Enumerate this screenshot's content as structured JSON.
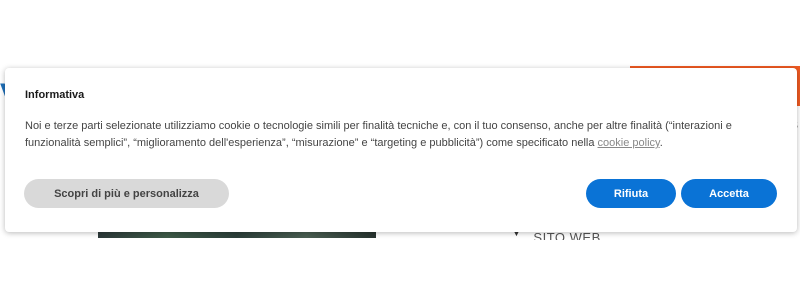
{
  "background": {
    "logo_fragment": "V",
    "right_fragment": "s",
    "caption_fragment": "SITO WEB RESPONSIVE"
  },
  "banner": {
    "title": "Informativa",
    "text_before_link": "Noi e terze parti selezionate utilizziamo cookie o tecnologie simili per finalità tecniche e, con il tuo consenso, anche per altre finalità (“interazioni e funzionalità semplici”, “miglioramento dell'esperienza”, “misurazione” e “targeting e pubblicità”) come specificato nella ",
    "link_text": "cookie policy",
    "text_after_link": ".",
    "customize_label": "Scopri di più e personalizza",
    "reject_label": "Rifiuta",
    "accept_label": "Accetta"
  },
  "colors": {
    "primary": "#0a73d6",
    "secondary_button": "#d9d9d9",
    "orange_accent": "#ef5a22"
  }
}
